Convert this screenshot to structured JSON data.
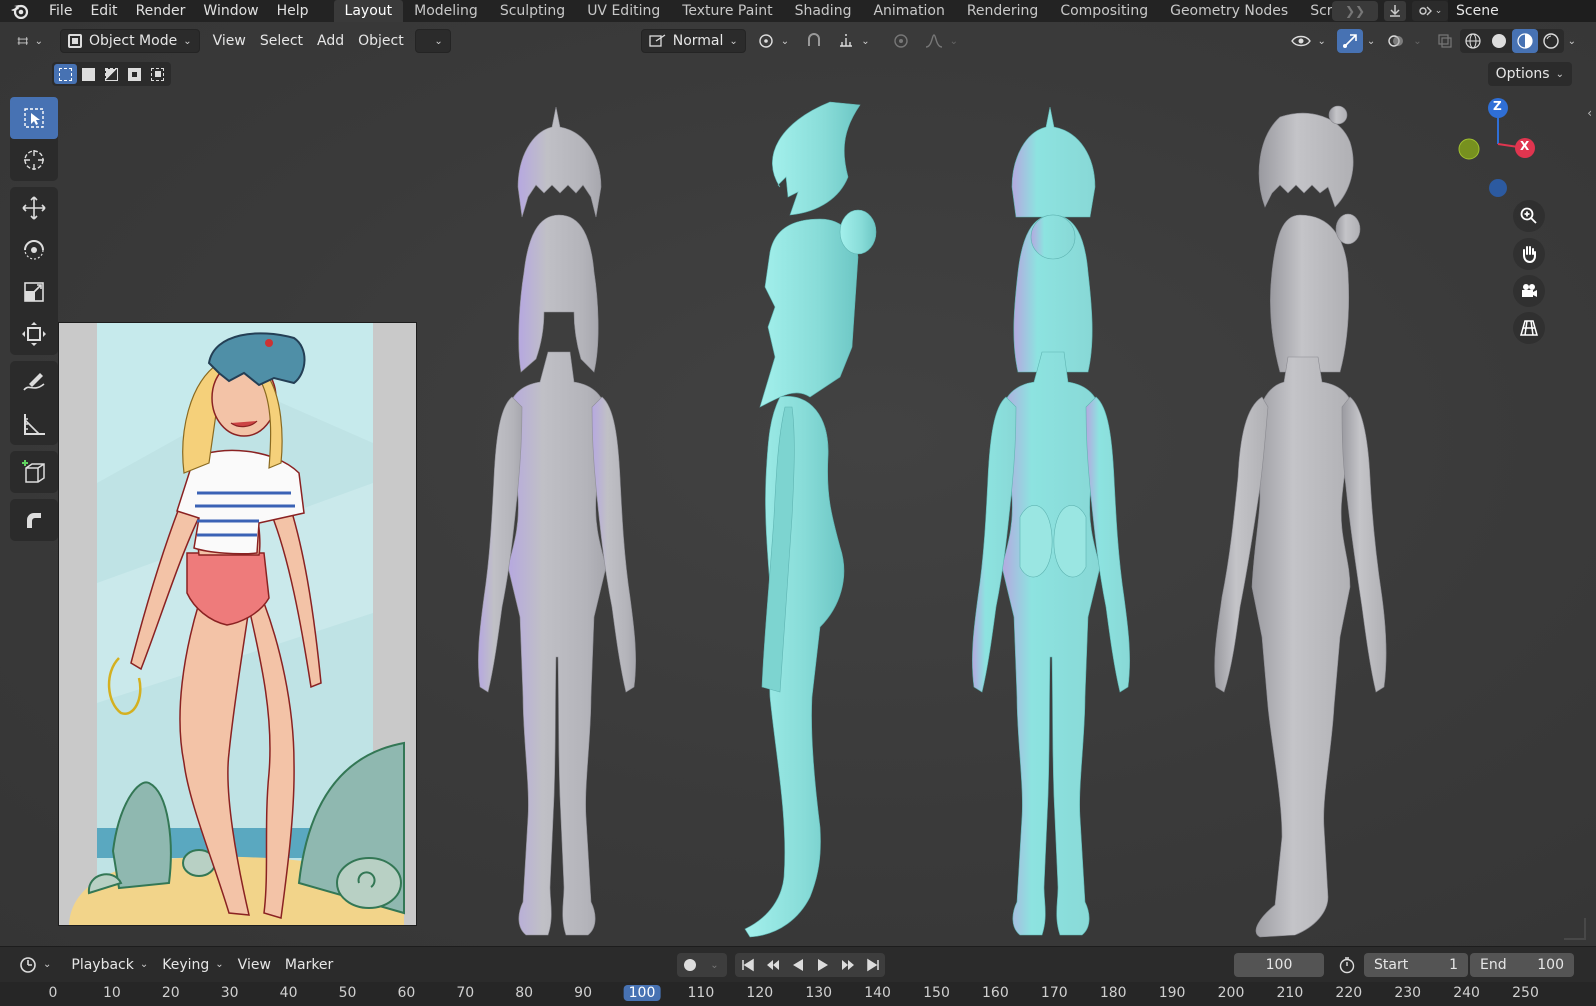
{
  "top_menu": {
    "items": [
      "File",
      "Edit",
      "Render",
      "Window",
      "Help"
    ]
  },
  "workspaces": {
    "tabs": [
      "Layout",
      "Modeling",
      "Sculpting",
      "UV Editing",
      "Texture Paint",
      "Shading",
      "Animation",
      "Rendering",
      "Compositing",
      "Geometry Nodes",
      "Scripting"
    ],
    "active": "Layout"
  },
  "scene": {
    "label": "Scene"
  },
  "viewport_header": {
    "mode": "Object Mode",
    "menus": [
      "View",
      "Select",
      "Add",
      "Object"
    ],
    "orientation": "Normal",
    "options": "Options"
  },
  "gizmo": {
    "z": "Z",
    "x": "X"
  },
  "timeline": {
    "menus": [
      "Playback",
      "Keying",
      "View",
      "Marker"
    ],
    "current_frame": "100",
    "start_label": "Start",
    "start_value": "1",
    "end_label": "End",
    "end_value": "100",
    "ticks": [
      "0",
      "10",
      "20",
      "30",
      "40",
      "50",
      "60",
      "70",
      "80",
      "90",
      "100",
      "110",
      "120",
      "130",
      "140",
      "150",
      "160",
      "170",
      "180",
      "190",
      "200",
      "210",
      "220",
      "230",
      "240",
      "250"
    ]
  },
  "colors": {
    "accent": "#4772b3",
    "model_cyan": "#8de3e0",
    "model_grey": "#b9b9bd",
    "model_lilac": "#b6a8e0"
  }
}
